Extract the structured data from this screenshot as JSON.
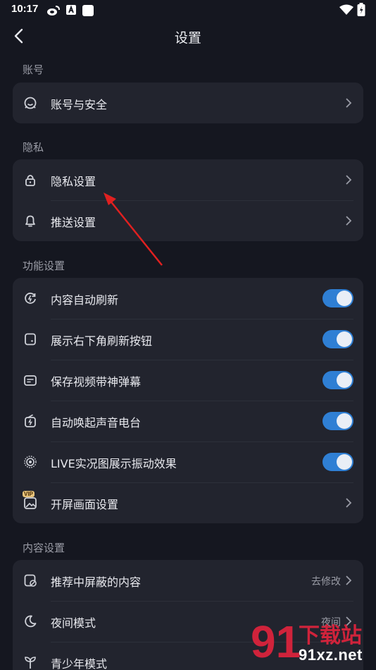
{
  "status": {
    "time": "10:17"
  },
  "header": {
    "title": "设置"
  },
  "sections": {
    "account": {
      "title": "账号",
      "items": [
        {
          "label": "账号与安全"
        }
      ]
    },
    "privacy": {
      "title": "隐私",
      "items": [
        {
          "label": "隐私设置"
        },
        {
          "label": "推送设置"
        }
      ]
    },
    "features": {
      "title": "功能设置",
      "items": [
        {
          "label": "内容自动刷新",
          "on": true
        },
        {
          "label": "展示右下角刷新按钮",
          "on": true
        },
        {
          "label": "保存视频带神弹幕",
          "on": true
        },
        {
          "label": "自动唤起声音电台",
          "on": true
        },
        {
          "label": "LIVE实况图展示振动效果",
          "on": true
        },
        {
          "label": "开屏画面设置",
          "badge": "VIP"
        }
      ]
    },
    "content": {
      "title": "内容设置",
      "items": [
        {
          "label": "推荐中屏蔽的内容",
          "value": "去修改"
        },
        {
          "label": "夜间模式",
          "value": "夜间"
        },
        {
          "label": "青少年模式"
        }
      ]
    }
  },
  "watermark": {
    "brand": "91xz.net",
    "chinese": "下载站"
  },
  "colors": {
    "background": "#151720",
    "card": "#22242e",
    "toggle_on": "#2f7fd4",
    "annotation_arrow": "#e02020"
  }
}
